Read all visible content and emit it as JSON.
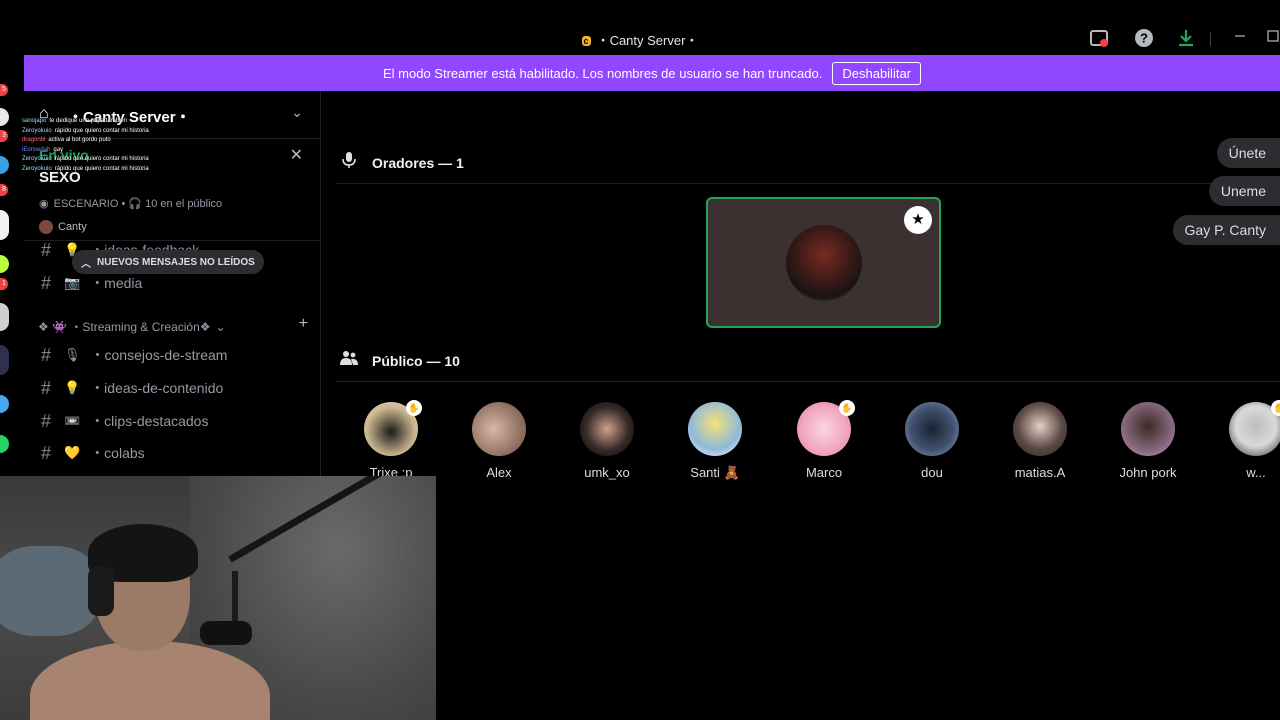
{
  "window": {
    "title_badge": "c",
    "title": "・Canty Server・",
    "icons": [
      "inbox-icon",
      "help-icon",
      "download-icon",
      "minimize-icon",
      "maximize-icon"
    ]
  },
  "banner": {
    "message": "El modo Streamer está habilitado. Los nombres de usuario se han truncado.",
    "button": "Deshabilitar",
    "color": "#9147ff"
  },
  "sidebar": {
    "server_name": "・Canty Server・",
    "stage": {
      "live_title": "En vivo",
      "topic": "SEXO",
      "meta": "ESCENARIO • 🎧 10 en el público",
      "speaker": "Canty"
    },
    "unread_pill": "NUEVOS MENSAJES NO LEÍDOS",
    "channels_top": [
      {
        "emoji": "💡",
        "name": "・ideas-feedback"
      },
      {
        "emoji": "📷",
        "name": "・media"
      }
    ],
    "category": "❖ 👾 ・Streaming & Creación❖",
    "channels": [
      {
        "emoji": "🎙",
        "name": "・consejos-de-stream"
      },
      {
        "emoji": "💡",
        "name": "・ideas-de-contenido"
      },
      {
        "emoji": "📼",
        "name": "・clips-destacados"
      },
      {
        "emoji": "💛",
        "name": "・colabs"
      }
    ]
  },
  "chat_overlay": [
    {
      "user": "sanojapo",
      "text": "te dedique una papa también"
    },
    {
      "user": "Zeroyokuio",
      "text": "rápido que quiero contar mi historia"
    },
    {
      "user": "dragonbl",
      "text": "activa al bot gordo puto"
    },
    {
      "user": "iEonsedah",
      "text": "gay"
    },
    {
      "user": "Zeroyokuio",
      "text": "rápido que quiero contar mi historia"
    },
    {
      "user": "Zeroyokuio",
      "text": "rápido que quiero contar mi historia"
    }
  ],
  "stage_main": {
    "speakers_header": "Oradores — 1",
    "audience_header": "Público — 10",
    "chips": [
      "Únete",
      "Uneme",
      "Gay P. Canty"
    ],
    "audience": [
      {
        "name": "Trixe :p",
        "color": "#c9b68e",
        "mark": true
      },
      {
        "name": "Alex",
        "color": "#8a6a5c",
        "mark": false
      },
      {
        "name": "umk_xo",
        "color": "#3a2c2a",
        "mark": false
      },
      {
        "name": "Santi 🧸",
        "color": "#f4e27a",
        "mark": false
      },
      {
        "name": "Marco",
        "color": "#f0a5c0",
        "mark": true
      },
      {
        "name": "dou",
        "color": "#41526e",
        "mark": false
      },
      {
        "name": "matias.A",
        "color": "#5d4a47",
        "mark": false
      },
      {
        "name": "John pork",
        "color": "#8c6d84",
        "mark": false
      },
      {
        "name": "w...",
        "color": "#d9d9d9",
        "mark": true
      }
    ]
  }
}
